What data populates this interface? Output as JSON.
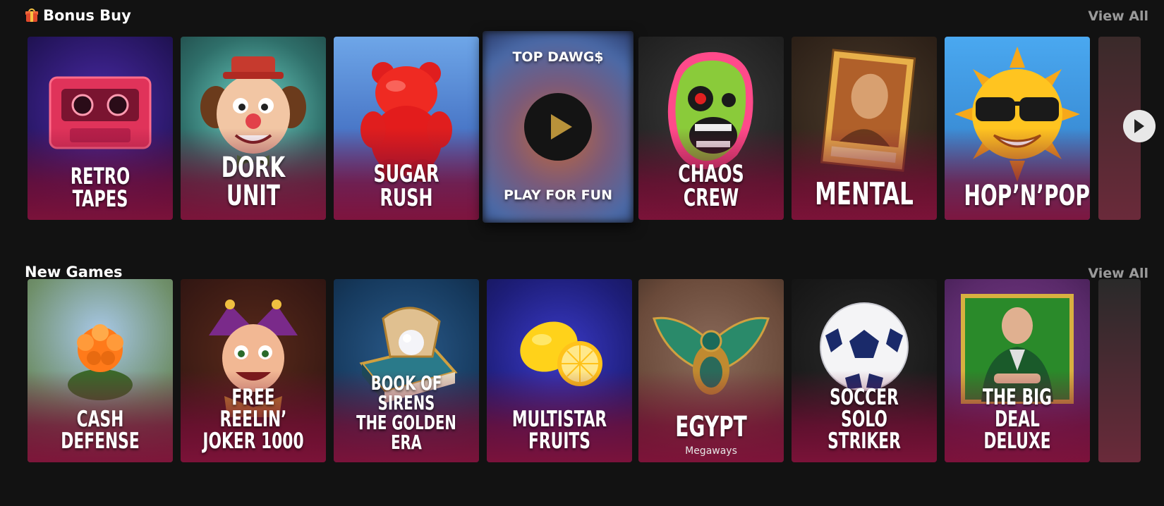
{
  "bonus_buy": {
    "title": "Bonus Buy",
    "view_all": "View All",
    "games": [
      {
        "name": "RETRO TAPES",
        "icon": "cassette-tape-icon",
        "bg": "#2a1b6e"
      },
      {
        "name": "DORK UNIT",
        "icon": "clown-face-icon",
        "bg": "#2f6f6a"
      },
      {
        "name": "SUGAR RUSH",
        "icon": "gummy-bear-icon",
        "bg": "#4a78c8"
      },
      {
        "name": "TOP DAWG$",
        "icon": "dog-icon",
        "bg": "#5a6fa8"
      },
      {
        "name": "CHAOS CREW",
        "icon": "zombie-skull-icon",
        "bg": "#2b2b2b"
      },
      {
        "name": "MENTAL",
        "icon": "patient-photo-icon",
        "bg": "#3a2a1e"
      },
      {
        "name": "HOP’N’POP",
        "icon": "sun-sunglasses-icon",
        "bg": "#3b8fd8"
      }
    ],
    "focused": {
      "top_label": "TOP DAWG$",
      "play_label": "PLAY FOR FUN"
    }
  },
  "new_games": {
    "title": "New Games",
    "view_all": "View All",
    "games": [
      {
        "name": "CASH DEFENSE",
        "icon": "flower-icon",
        "bg": "#6f8f6a"
      },
      {
        "name": "FREE REELIN’\nJOKER 1000",
        "icon": "jester-icon",
        "bg": "#3a1a14"
      },
      {
        "name": "BOOK OF SIRENS\nTHE GOLDEN ERA",
        "icon": "pearl-book-icon",
        "bg": "#163a5e"
      },
      {
        "name": "MULTISTAR\nFRUITS",
        "icon": "lemon-icon",
        "bg": "#1e1e7a"
      },
      {
        "name": "EGYPT",
        "subtitle": "Megaways",
        "icon": "scarab-icon",
        "bg": "#6a4a3a"
      },
      {
        "name": "SOCCER SOLO\nSTRIKER",
        "icon": "soccer-ball-icon",
        "bg": "#1a1a1a"
      },
      {
        "name": "THE BIG DEAL\nDELUXE",
        "icon": "businessman-icon",
        "bg": "#5a2a6a"
      }
    ]
  },
  "colors": {
    "background": "#121212",
    "accent_gold": "#b8923a",
    "card_gradient": "#80123a",
    "view_all": "#9a9a9a"
  }
}
